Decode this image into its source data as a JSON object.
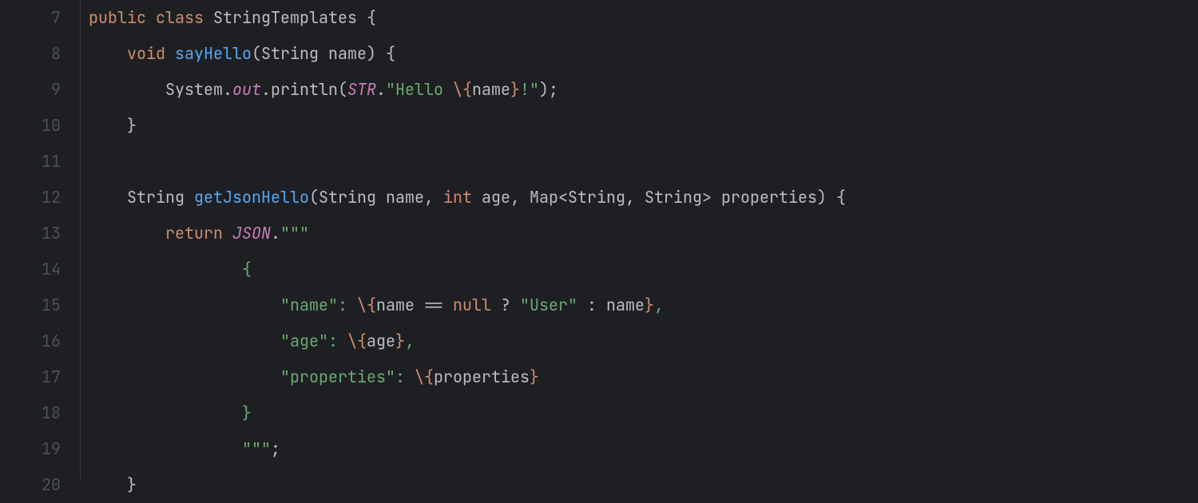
{
  "gutter": {
    "start": 7,
    "lines": [
      "7",
      "8",
      "9",
      "10",
      "11",
      "12",
      "13",
      "14",
      "15",
      "16",
      "17",
      "18",
      "19",
      "20"
    ]
  },
  "code": {
    "l7": {
      "kw_public": "public",
      "kw_class": "class",
      "name": "StringTemplates",
      "brace": "{"
    },
    "l8": {
      "indent": "    ",
      "kw_void": "void",
      "fn": "sayHello",
      "params_open": "(String name) {",
      "lparen": "(",
      "type_string": "String",
      "param_name": "name",
      "rparen_brace": ") {"
    },
    "l9": {
      "indent": "        ",
      "system": "System",
      "dot1": ".",
      "out": "out",
      "dot2": ".",
      "println": "println",
      "lparen": "(",
      "str_proc": "STR",
      "dot3": ".",
      "q1": "\"",
      "s1": "Hello ",
      "esc_open": "\\{",
      "expr": "name",
      "esc_close": "}",
      "s2": "!",
      "q2": "\"",
      "rparen_semi": ");"
    },
    "l10": {
      "indent": "    ",
      "brace": "}"
    },
    "l11": {
      "blank": ""
    },
    "l12": {
      "indent": "    ",
      "ret_type": "String",
      "fn": "getJsonHello",
      "lparen": "(",
      "t1": "String",
      "p1": "name",
      "c1": ", ",
      "t2": "int",
      "p2": "age",
      "c2": ", ",
      "t3": "Map",
      "lt": "<",
      "g1": "String",
      "gc": ", ",
      "g2": "String",
      "gt": ">",
      "p3": "properties",
      "rparen_brace": ") {"
    },
    "l13": {
      "indent": "        ",
      "kw_return": "return",
      "sp": " ",
      "json": "JSON",
      "dot": ".",
      "tq": "\"\"\""
    },
    "l14": {
      "indent": "                ",
      "brace": "{"
    },
    "l15": {
      "indent": "                    ",
      "key": "\"name\": ",
      "esc_open": "\\{",
      "expr_a": "name ",
      "eqeq": "== ",
      "kw_null": "null",
      "expr_b": " ? ",
      "user_str": "\"User\"",
      "expr_c": " : name",
      "esc_close": "}",
      "comma": ","
    },
    "l16": {
      "indent": "                    ",
      "key": "\"age\": ",
      "esc_open": "\\{",
      "expr": "age",
      "esc_close": "}",
      "comma": ","
    },
    "l17": {
      "indent": "                    ",
      "key": "\"properties\": ",
      "esc_open": "\\{",
      "expr": "properties",
      "esc_close": "}"
    },
    "l18": {
      "indent": "                ",
      "brace": "}"
    },
    "l19": {
      "indent": "                ",
      "tq": "\"\"\"",
      "semi": ";"
    },
    "l20": {
      "indent": "    ",
      "brace": "}"
    }
  }
}
